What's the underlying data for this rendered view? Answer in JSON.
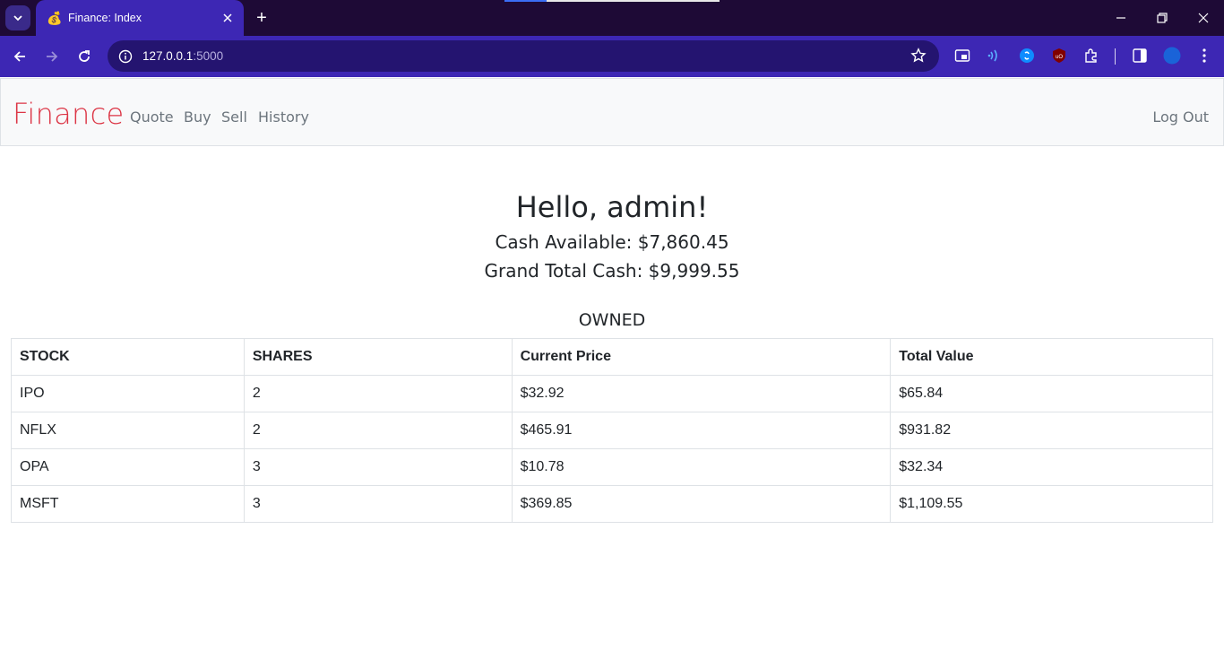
{
  "browser": {
    "tab_title": "Finance: Index",
    "favicon": "money-bag-icon",
    "url_host": "127.0.0.1",
    "url_port": ":5000"
  },
  "navbar": {
    "brand": "Finance",
    "links": [
      "Quote",
      "Buy",
      "Sell",
      "History"
    ],
    "logout": "Log Out"
  },
  "summary": {
    "greeting": "Hello, admin!",
    "cash_available": "Cash Available: $7,860.45",
    "grand_total": "Grand Total Cash: $9,999.55"
  },
  "holdings": {
    "heading": "OWNED",
    "columns": [
      "STOCK",
      "SHARES",
      "Current Price",
      "Total Value"
    ],
    "rows": [
      [
        "IPO",
        "2",
        "$32.92",
        "$65.84"
      ],
      [
        "NFLX",
        "2",
        "$465.91",
        "$931.82"
      ],
      [
        "OPA",
        "3",
        "$10.78",
        "$32.34"
      ],
      [
        "MSFT",
        "3",
        "$369.85",
        "$1,109.55"
      ]
    ]
  },
  "colors": {
    "brand": "#dc3545",
    "chrome": "#3d27b4",
    "tabbar": "#1e0a36"
  }
}
